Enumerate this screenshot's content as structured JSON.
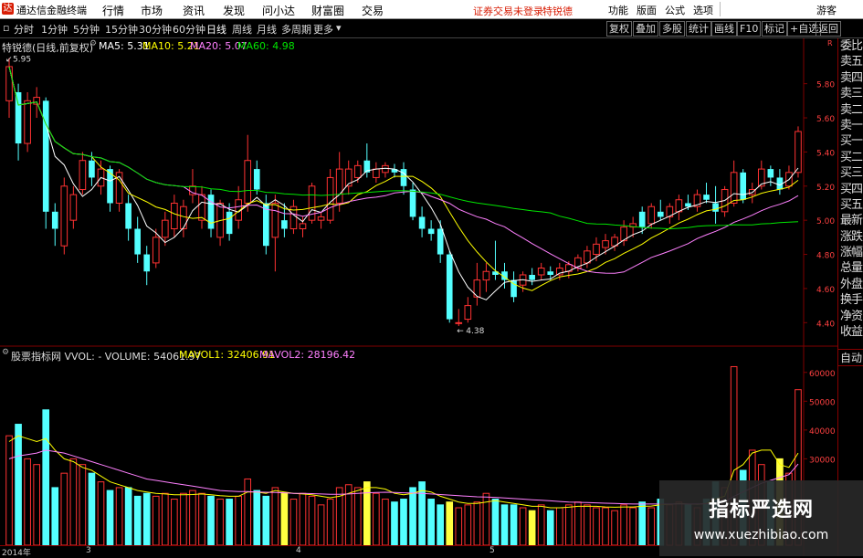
{
  "menubar": {
    "app_title": "通达信金融终端",
    "items": [
      "行情",
      "市场",
      "资讯",
      "发现",
      "问小达",
      "财富圈",
      "交易"
    ],
    "notice": "证券交易未登录",
    "stock_link": "特锐德",
    "right_items": [
      "功能",
      "版面",
      "公式",
      "选项"
    ],
    "guest": "游客"
  },
  "toolbar": {
    "periods": [
      "分时",
      "1分钟",
      "5分钟",
      "15分钟",
      "30分钟",
      "60分钟",
      "日线",
      "周线",
      "月线",
      "多周期",
      "更多"
    ],
    "active_period": "日线",
    "tools": [
      "复权",
      "叠加",
      "多股",
      "统计",
      "画线",
      "F10",
      "标记",
      "+自选",
      "返回"
    ]
  },
  "price_panel": {
    "stock_label": "特锐德(日线,前复权)",
    "ma5_label": "MA5: 5.31",
    "ma10_label": "MA10: 5.21",
    "ma20_label": "MA20: 5.07",
    "ma60_label": "MA60: 4.98",
    "high_mark": "5.95",
    "low_mark": "4.38",
    "corner_tag": "R",
    "axis_ticks": [
      "5.80",
      "5.60",
      "5.40",
      "5.20",
      "5.00",
      "4.80",
      "4.60",
      "4.40"
    ]
  },
  "volume_panel": {
    "label": "股票指标网 VVOL: - VOLUME: 54061.97",
    "mavol1_label": "MAVOL1: 32406.91",
    "mavol2_label": "MAVOL2: 28196.42",
    "axis_ticks": [
      "60000",
      "50000",
      "40000",
      "30000"
    ]
  },
  "date_axis": {
    "labels": [
      "2014年",
      "3",
      "4",
      "5"
    ]
  },
  "right_panel": {
    "items": [
      "委比",
      "卖五",
      "卖四",
      "卖三",
      "卖二",
      "卖一",
      "买一",
      "买二",
      "买三",
      "买四",
      "买五",
      "最新",
      "涨跌",
      "涨幅",
      "总量",
      "外盘",
      "换手",
      "净资",
      "收益"
    ],
    "auto": "自动"
  },
  "watermark": {
    "line1": "指标严选网",
    "line2": "www.xuezhibiao.com"
  },
  "colors": {
    "up": "#ff3232",
    "down": "#54ffff",
    "ma5": "#ffffff",
    "ma10": "#ffff00",
    "ma20": "#ff80ff",
    "ma60": "#00e600",
    "vol_yellow": "#ffff40",
    "grid": "#800000"
  },
  "chart_data": {
    "type": "candlestick",
    "price_range": [
      4.3,
      5.98
    ],
    "volume_range": [
      0,
      65000
    ],
    "candles": [
      {
        "o": 5.7,
        "h": 5.95,
        "l": 5.6,
        "c": 5.9
      },
      {
        "o": 5.75,
        "h": 5.8,
        "l": 5.35,
        "c": 5.45
      },
      {
        "o": 5.45,
        "h": 5.75,
        "l": 5.4,
        "c": 5.7
      },
      {
        "o": 5.68,
        "h": 5.78,
        "l": 5.6,
        "c": 5.72
      },
      {
        "o": 5.7,
        "h": 5.72,
        "l": 4.95,
        "c": 5.05
      },
      {
        "o": 5.05,
        "h": 5.1,
        "l": 4.85,
        "c": 4.95
      },
      {
        "o": 4.85,
        "h": 5.25,
        "l": 4.8,
        "c": 5.2
      },
      {
        "o": 5.0,
        "h": 5.2,
        "l": 4.95,
        "c": 5.15
      },
      {
        "o": 5.18,
        "h": 5.4,
        "l": 5.15,
        "c": 5.35
      },
      {
        "o": 5.35,
        "h": 5.4,
        "l": 5.2,
        "c": 5.25
      },
      {
        "o": 5.2,
        "h": 5.35,
        "l": 5.15,
        "c": 5.3
      },
      {
        "o": 5.3,
        "h": 5.32,
        "l": 5.05,
        "c": 5.1
      },
      {
        "o": 5.1,
        "h": 5.3,
        "l": 5.05,
        "c": 5.28
      },
      {
        "o": 5.1,
        "h": 5.15,
        "l": 4.88,
        "c": 4.95
      },
      {
        "o": 4.95,
        "h": 5.02,
        "l": 4.75,
        "c": 4.8
      },
      {
        "o": 4.8,
        "h": 4.85,
        "l": 4.62,
        "c": 4.7
      },
      {
        "o": 4.75,
        "h": 4.95,
        "l": 4.72,
        "c": 4.9
      },
      {
        "o": 4.9,
        "h": 5.05,
        "l": 4.85,
        "c": 5.0
      },
      {
        "o": 4.95,
        "h": 5.15,
        "l": 4.9,
        "c": 5.1
      },
      {
        "o": 4.95,
        "h": 5.12,
        "l": 4.9,
        "c": 5.08
      },
      {
        "o": 5.15,
        "h": 5.3,
        "l": 5.1,
        "c": 5.2
      },
      {
        "o": 5.0,
        "h": 5.2,
        "l": 4.95,
        "c": 5.15
      },
      {
        "o": 5.15,
        "h": 5.18,
        "l": 4.9,
        "c": 4.95
      },
      {
        "o": 4.9,
        "h": 5.12,
        "l": 4.85,
        "c": 5.1
      },
      {
        "o": 5.05,
        "h": 5.1,
        "l": 4.88,
        "c": 4.92
      },
      {
        "o": 5.0,
        "h": 5.2,
        "l": 4.95,
        "c": 5.12
      },
      {
        "o": 5.1,
        "h": 5.5,
        "l": 5.05,
        "c": 5.35
      },
      {
        "o": 5.3,
        "h": 5.35,
        "l": 5.15,
        "c": 5.18
      },
      {
        "o": 5.1,
        "h": 5.15,
        "l": 4.8,
        "c": 4.85
      },
      {
        "o": 4.9,
        "h": 5.15,
        "l": 4.7,
        "c": 5.1
      },
      {
        "o": 5.0,
        "h": 5.1,
        "l": 4.9,
        "c": 4.95
      },
      {
        "o": 4.95,
        "h": 5.12,
        "l": 4.92,
        "c": 5.08
      },
      {
        "o": 4.95,
        "h": 5.02,
        "l": 4.9,
        "c": 4.98
      },
      {
        "o": 5.0,
        "h": 5.22,
        "l": 4.98,
        "c": 5.2
      },
      {
        "o": 5.0,
        "h": 5.05,
        "l": 4.95,
        "c": 5.02
      },
      {
        "o": 5.0,
        "h": 5.3,
        "l": 4.98,
        "c": 5.25
      },
      {
        "o": 5.1,
        "h": 5.4,
        "l": 5.05,
        "c": 5.3
      },
      {
        "o": 5.2,
        "h": 5.35,
        "l": 5.15,
        "c": 5.3
      },
      {
        "o": 5.25,
        "h": 5.35,
        "l": 5.22,
        "c": 5.32
      },
      {
        "o": 5.35,
        "h": 5.45,
        "l": 5.25,
        "c": 5.28
      },
      {
        "o": 5.25,
        "h": 5.34,
        "l": 5.22,
        "c": 5.3
      },
      {
        "o": 5.28,
        "h": 5.34,
        "l": 5.25,
        "c": 5.32
      },
      {
        "o": 5.3,
        "h": 5.33,
        "l": 5.25,
        "c": 5.28
      },
      {
        "o": 5.3,
        "h": 5.34,
        "l": 5.15,
        "c": 5.2
      },
      {
        "o": 5.18,
        "h": 5.22,
        "l": 5.0,
        "c": 5.02
      },
      {
        "o": 5.02,
        "h": 5.08,
        "l": 4.9,
        "c": 4.95
      },
      {
        "o": 4.95,
        "h": 5.0,
        "l": 4.88,
        "c": 4.92
      },
      {
        "o": 4.95,
        "h": 5.0,
        "l": 4.75,
        "c": 4.8
      },
      {
        "o": 4.8,
        "h": 4.82,
        "l": 4.4,
        "c": 4.42
      },
      {
        "o": 4.4,
        "h": 4.48,
        "l": 4.38,
        "c": 4.4
      },
      {
        "o": 4.42,
        "h": 4.55,
        "l": 4.4,
        "c": 4.5
      },
      {
        "o": 4.55,
        "h": 4.75,
        "l": 4.5,
        "c": 4.65
      },
      {
        "o": 4.65,
        "h": 4.75,
        "l": 4.58,
        "c": 4.7
      },
      {
        "o": 4.7,
        "h": 4.88,
        "l": 4.65,
        "c": 4.68
      },
      {
        "o": 4.7,
        "h": 4.75,
        "l": 4.6,
        "c": 4.65
      },
      {
        "o": 4.65,
        "h": 4.7,
        "l": 4.52,
        "c": 4.55
      },
      {
        "o": 4.62,
        "h": 4.7,
        "l": 4.58,
        "c": 4.68
      },
      {
        "o": 4.68,
        "h": 4.72,
        "l": 4.62,
        "c": 4.65
      },
      {
        "o": 4.68,
        "h": 4.75,
        "l": 4.65,
        "c": 4.72
      },
      {
        "o": 4.7,
        "h": 4.73,
        "l": 4.65,
        "c": 4.68
      },
      {
        "o": 4.68,
        "h": 4.75,
        "l": 4.65,
        "c": 4.72
      },
      {
        "o": 4.7,
        "h": 4.76,
        "l": 4.66,
        "c": 4.74
      },
      {
        "o": 4.72,
        "h": 4.8,
        "l": 4.7,
        "c": 4.78
      },
      {
        "o": 4.75,
        "h": 4.85,
        "l": 4.72,
        "c": 4.82
      },
      {
        "o": 4.8,
        "h": 4.9,
        "l": 4.76,
        "c": 4.86
      },
      {
        "o": 4.84,
        "h": 4.92,
        "l": 4.8,
        "c": 4.88
      },
      {
        "o": 4.85,
        "h": 4.92,
        "l": 4.82,
        "c": 4.9
      },
      {
        "o": 4.88,
        "h": 5.0,
        "l": 4.85,
        "c": 4.96
      },
      {
        "o": 4.96,
        "h": 5.02,
        "l": 4.9,
        "c": 4.98
      },
      {
        "o": 5.05,
        "h": 5.08,
        "l": 4.92,
        "c": 4.96
      },
      {
        "o": 4.98,
        "h": 5.1,
        "l": 4.95,
        "c": 5.08
      },
      {
        "o": 5.05,
        "h": 5.12,
        "l": 5.0,
        "c": 5.02
      },
      {
        "o": 5.02,
        "h": 5.1,
        "l": 4.98,
        "c": 5.08
      },
      {
        "o": 5.05,
        "h": 5.15,
        "l": 5.0,
        "c": 5.12
      },
      {
        "o": 5.1,
        "h": 5.15,
        "l": 5.06,
        "c": 5.08
      },
      {
        "o": 5.08,
        "h": 5.18,
        "l": 5.05,
        "c": 5.15
      },
      {
        "o": 5.15,
        "h": 5.22,
        "l": 5.1,
        "c": 5.12
      },
      {
        "o": 5.1,
        "h": 5.2,
        "l": 4.98,
        "c": 5.05
      },
      {
        "o": 5.05,
        "h": 5.2,
        "l": 5.02,
        "c": 5.18
      },
      {
        "o": 5.1,
        "h": 5.35,
        "l": 5.08,
        "c": 5.28
      },
      {
        "o": 5.28,
        "h": 5.3,
        "l": 5.1,
        "c": 5.12
      },
      {
        "o": 5.15,
        "h": 5.22,
        "l": 5.1,
        "c": 5.18
      },
      {
        "o": 5.2,
        "h": 5.35,
        "l": 5.18,
        "c": 5.3
      },
      {
        "o": 5.3,
        "h": 5.32,
        "l": 5.2,
        "c": 5.25
      },
      {
        "o": 5.25,
        "h": 5.3,
        "l": 5.15,
        "c": 5.18
      },
      {
        "o": 5.2,
        "h": 5.32,
        "l": 5.18,
        "c": 5.28
      },
      {
        "o": 5.28,
        "h": 5.55,
        "l": 5.25,
        "c": 5.52
      }
    ],
    "volumes": [
      38000,
      42000,
      30000,
      28000,
      47000,
      20000,
      25000,
      30000,
      28000,
      25000,
      22000,
      19000,
      20000,
      20000,
      17000,
      18000,
      17000,
      18000,
      16000,
      18000,
      19000,
      18000,
      17000,
      16000,
      16000,
      17000,
      23000,
      19000,
      17000,
      20000,
      18000,
      16000,
      18000,
      17000,
      14000,
      16000,
      20000,
      21000,
      20000,
      22000,
      18000,
      16000,
      15000,
      16000,
      20000,
      22000,
      16000,
      14000,
      15000,
      13000,
      14000,
      15000,
      18000,
      16000,
      14000,
      14000,
      13000,
      12000,
      14000,
      12000,
      13000,
      14000,
      15000,
      14000,
      13000,
      13000,
      12000,
      14000,
      13000,
      15000,
      13000,
      16000,
      14000,
      15000,
      14000,
      13000,
      16000,
      22000,
      20000,
      62000,
      26000,
      33000,
      28000,
      22000,
      30000,
      25000,
      54000
    ],
    "mavol1_line": [
      36000,
      38000,
      37000,
      36000,
      37000,
      33000,
      30000,
      29000,
      27000,
      26000,
      24000,
      22000,
      21000,
      20000,
      19000,
      18500,
      18000,
      17800,
      17500,
      17500,
      17600,
      17800,
      17500,
      17200,
      17000,
      17000,
      18500,
      18500,
      18000,
      19000,
      18500,
      18000,
      17800,
      17500,
      17000,
      16500,
      17000,
      18000,
      19000,
      20000,
      20000,
      19500,
      18000,
      17500,
      18000,
      19000,
      18500,
      17000,
      16000,
      15000,
      14500,
      14500,
      15000,
      15500,
      15000,
      14500,
      14000,
      13500,
      13500,
      13000,
      13000,
      13200,
      13500,
      13500,
      13500,
      13300,
      13200,
      13300,
      13300,
      13500,
      13600,
      14000,
      14200,
      14500,
      14300,
      14200,
      14500,
      16000,
      17000,
      26000,
      28000,
      32000,
      33000,
      33000,
      28000,
      27000,
      32000
    ],
    "mavol2_line": [
      30000,
      31000,
      31500,
      32000,
      33000,
      32500,
      32000,
      31000,
      30000,
      29000,
      28000,
      27000,
      26000,
      25000,
      24000,
      23000,
      22500,
      22000,
      21500,
      21000,
      20500,
      20000,
      19500,
      19000,
      18800,
      18600,
      18600,
      18500,
      18400,
      18300,
      18200,
      18000,
      18000,
      17900,
      17800,
      17700,
      17700,
      17800,
      18000,
      18200,
      18300,
      18400,
      18300,
      18200,
      18100,
      18000,
      17800,
      17600,
      17400,
      17200,
      17000,
      16800,
      16700,
      16600,
      16400,
      16200,
      16000,
      15800,
      15600,
      15400,
      15200,
      15000,
      14900,
      14800,
      14700,
      14600,
      14500,
      14400,
      14300,
      14300,
      14300,
      14300,
      14300,
      14300,
      14300,
      14300,
      14400,
      14600,
      15000,
      17000,
      18500,
      20000,
      21500,
      22500,
      23500,
      24500,
      28196
    ]
  }
}
